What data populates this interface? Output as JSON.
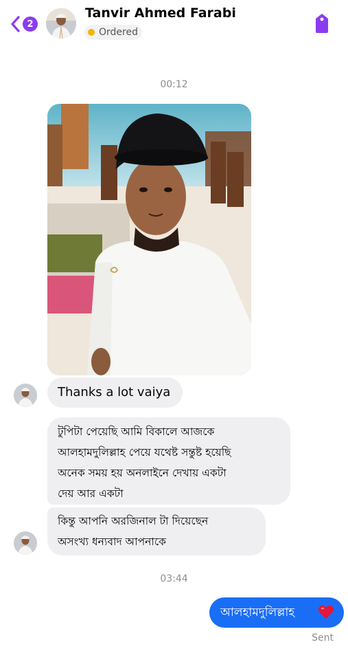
{
  "header": {
    "unread_count": "2",
    "contact_name": "Tanvir Ahmed Farabi",
    "status_label": "Ordered",
    "status_color": "#f5b400",
    "accent_color": "#8c3cf0",
    "back_icon": "chevron-left-icon",
    "tag_icon": "tag-icon"
  },
  "messages": {
    "time_1": "00:12",
    "msg_1": "Thanks a lot vaiya",
    "msg_2": "টুপিটা পেয়েছি আমি বিকালে আজকে\nআলহামদুলিল্লাহ পেয়ে যথেষ্ট সন্তুষ্ট হয়েছি\nঅনেক সময় হয় অনলাইনে দেখায় একটা\nদেয় আর একটা",
    "msg_3": "কিন্তু আপনি অরজিনাল টা দিয়েছেন\nঅসংখ্য ধন্যবাদ আপনাকে",
    "time_2": "03:44",
    "outgoing": "আলহামদুলিল্লাহ",
    "outgoing_emoji": "heart-icon",
    "outgoing_color": "#1a6ef5",
    "sent_label": "Sent"
  }
}
